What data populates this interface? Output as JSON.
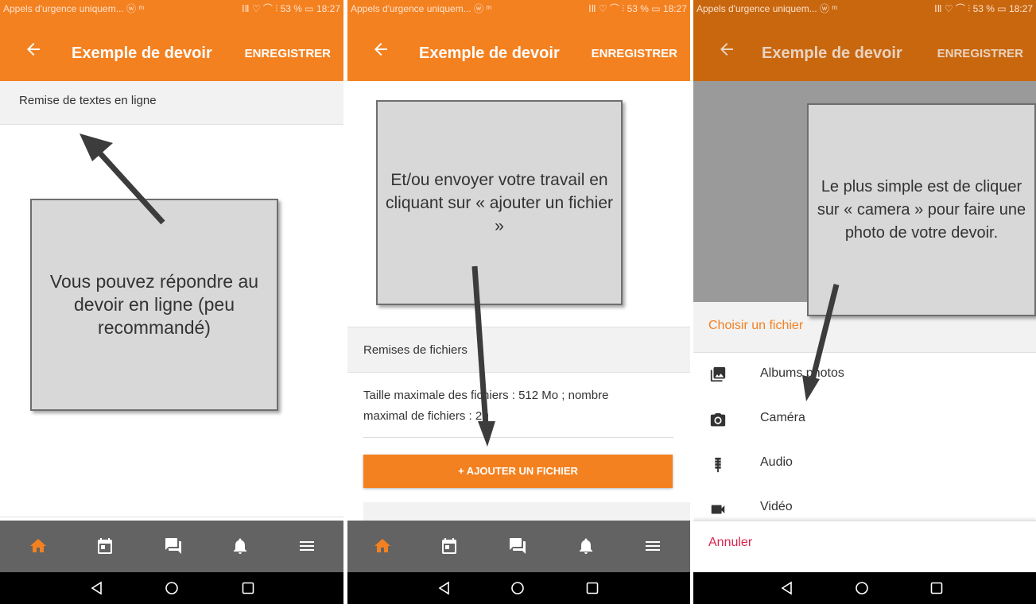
{
  "colors": {
    "orange": "#f48120",
    "darkgray": "#636363",
    "cancel": "#d9254c"
  },
  "status": {
    "left": "Appels d'urgence uniquem... ⓦ ᵐ",
    "right": "ⅠⅡ ♡ ⌒ ⫶ 53 % ▭ 18:27"
  },
  "appbar": {
    "title": "Exemple de devoir",
    "save": "ENREGISTRER"
  },
  "screen1": {
    "section": "Remise de textes en ligne",
    "callout": "Vous pouvez répondre au devoir en ligne (peu recommandé)"
  },
  "screen2": {
    "callout": "Et/ou envoyer votre travail en cliquant sur « ajouter un fichier »",
    "section": "Remises de fichiers",
    "limits_line1": "Taille maximale des fichiers : 512 Mo ; nombre",
    "limits_line2": "maximal de fichiers : 20",
    "add_button": "+ AJOUTER UN FICHIER"
  },
  "screen3": {
    "callout": "Le plus simple est de cliquer sur « camera » pour faire une photo de votre devoir.",
    "sheet_title": "Choisir un fichier",
    "options": [
      {
        "label": "Albums photos",
        "icon": "image-icon"
      },
      {
        "label": "Caméra",
        "icon": "camera-icon"
      },
      {
        "label": "Audio",
        "icon": "microphone-icon"
      },
      {
        "label": "Vidéo",
        "icon": "videocam-icon"
      }
    ],
    "cancel": "Annuler"
  },
  "tabbar": {
    "tabs": [
      "home-icon",
      "calendar-icon",
      "messages-icon",
      "notifications-icon",
      "menu-icon"
    ]
  },
  "navbar": {
    "buttons": [
      "back-nav-icon",
      "home-nav-icon",
      "recents-nav-icon"
    ]
  }
}
